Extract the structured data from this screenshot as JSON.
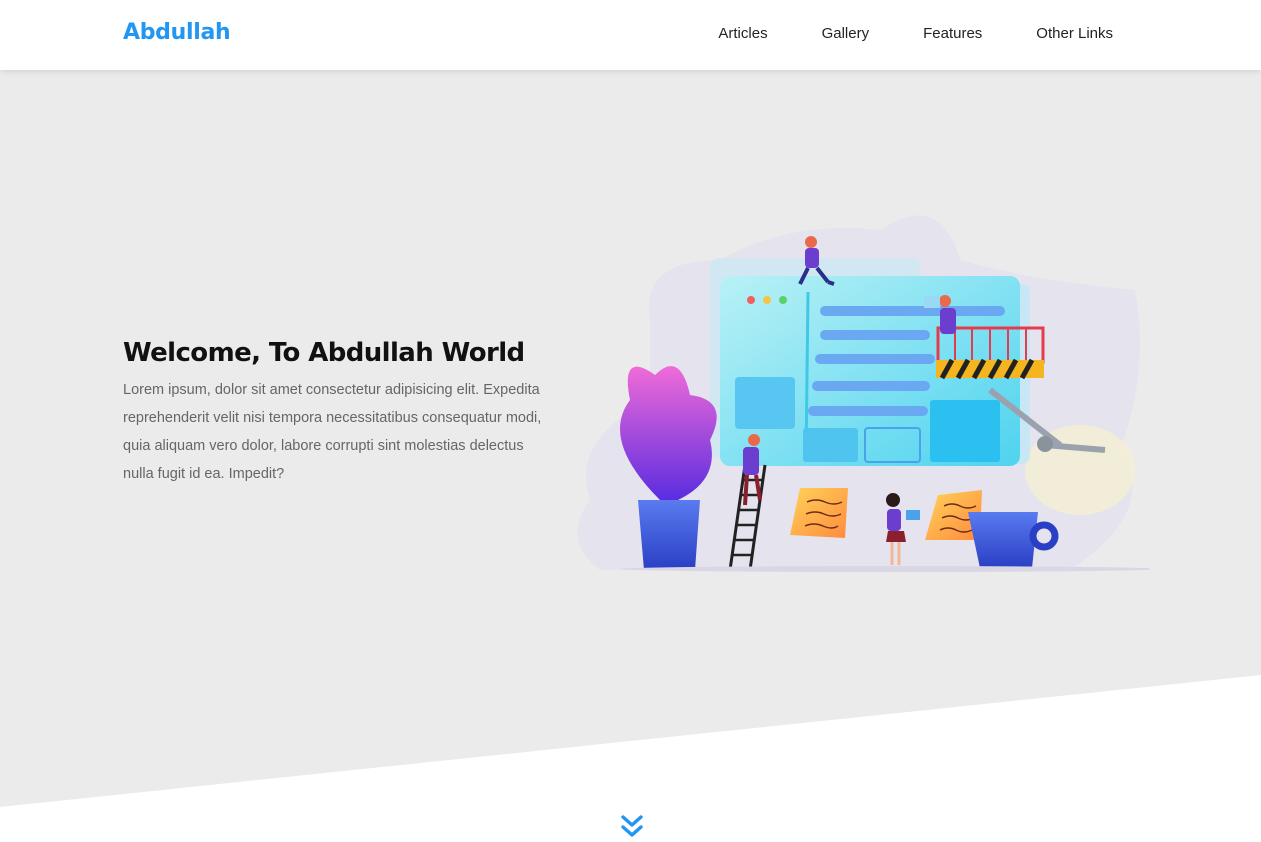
{
  "header": {
    "logo": "Abdullah",
    "nav": [
      "Articles",
      "Gallery",
      "Features",
      "Other Links"
    ]
  },
  "landing": {
    "title": "Welcome, To Abdullah World",
    "description": "Lorem ipsum, dolor sit amet consectetur adipisicing elit. Expedita reprehenderit velit nisi tempora necessitatibus consequatur modi, quia aliquam vero dolor, labore corrupti sint molestias delectus nulla fugit id ea. Impedit?",
    "illustration_icon": "web-development-illustration",
    "scroll_icon": "angles-down-icon"
  },
  "colors": {
    "accent": "#2196f3",
    "landing_bg": "#ebebeb",
    "text_dark": "#111111",
    "text_muted": "#666666"
  }
}
